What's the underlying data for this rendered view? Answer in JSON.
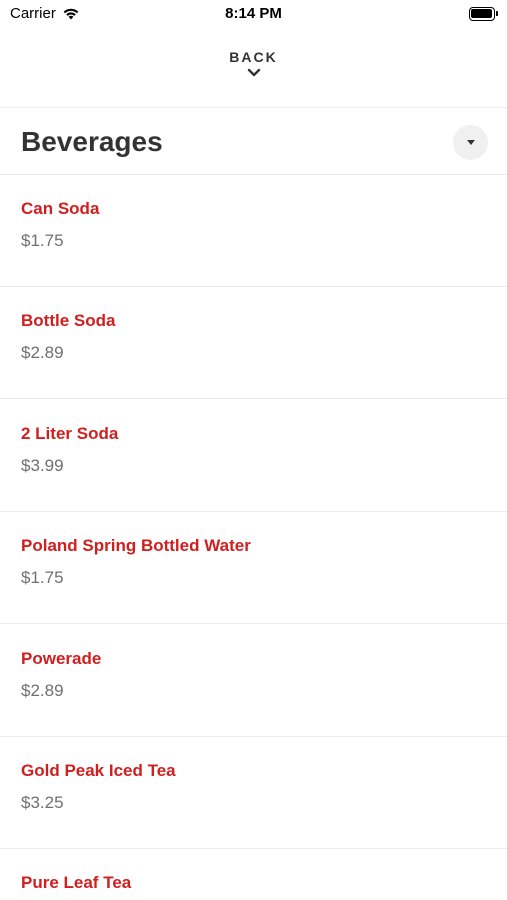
{
  "status_bar": {
    "carrier": "Carrier",
    "time": "8:14 PM",
    "wifi_icon": "wifi-icon",
    "battery_icon": "battery-icon"
  },
  "nav": {
    "back_label": "BACK",
    "back_icon": "chevron-down-icon"
  },
  "category": {
    "title": "Beverages",
    "toggle_icon": "caret-down-icon"
  },
  "colors": {
    "item_name": "#d01f1f",
    "price": "#707070",
    "title": "#333333",
    "divider": "#ececec"
  },
  "items": [
    {
      "name": "Can Soda",
      "price": "$1.75"
    },
    {
      "name": "Bottle Soda",
      "price": "$2.89"
    },
    {
      "name": "2 Liter Soda",
      "price": "$3.99"
    },
    {
      "name": "Poland Spring Bottled Water",
      "price": "$1.75"
    },
    {
      "name": "Powerade",
      "price": "$2.89"
    },
    {
      "name": "Gold Peak Iced Tea",
      "price": "$3.25"
    },
    {
      "name": "Pure Leaf Tea",
      "price": ""
    }
  ]
}
